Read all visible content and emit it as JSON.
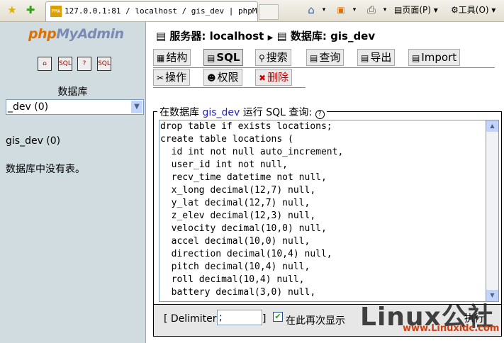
{
  "browser": {
    "tab_title": "127.0.0.1:81 / localhost / gis_dev | phpM...",
    "favicon_text": "PMA",
    "toolbar": {
      "page_label": "页面(P)",
      "tools_label": "工具(O)"
    }
  },
  "sidebar": {
    "logo_php": "php",
    "logo_myadmin": "MyAdmin",
    "icon_buttons": [
      "home",
      "SQL",
      "?",
      "SQL"
    ],
    "db_label": "数据库",
    "selected_db": "_dev (0)",
    "db_link": "gis_dev (0)",
    "empty_message": "数据库中没有表。"
  },
  "main": {
    "breadcrumb": {
      "server": "服务器: localhost",
      "database": "数据库: gis_dev"
    },
    "tabs_row1": [
      {
        "label": "结构",
        "icon": "structure-icon"
      },
      {
        "label": "SQL",
        "icon": "sql-icon",
        "active": true
      },
      {
        "label": "搜索",
        "icon": "search-icon"
      },
      {
        "label": "查询",
        "icon": "query-icon"
      },
      {
        "label": "导出",
        "icon": "export-icon"
      },
      {
        "label": "Import",
        "icon": "import-icon"
      }
    ],
    "tabs_row2": [
      {
        "label": "操作",
        "icon": "operations-icon"
      },
      {
        "label": "权限",
        "icon": "privileges-icon"
      },
      {
        "label": "删除",
        "icon": "drop-icon"
      }
    ],
    "query_legend": {
      "prefix": "在数据库",
      "db": "gis_dev",
      "suffix": "运行 SQL 查询:",
      "help": "?"
    },
    "sql_text": "drop table if exists locations;\ncreate table locations (\n  id int not null auto_increment,\n  user_id int not null,\n  recv_time datetime not null,\n  x_long decimal(12,7) null,\n  y_lat decimal(12,7) null,\n  z_elev decimal(12,3) null,\n  velocity decimal(10,0) null,\n  accel decimal(10,0) null,\n  direction decimal(10,4) null,\n  pitch decimal(10,4) null,\n  roll decimal(10,4) null,\n  battery decimal(3,0) null,",
    "delimiter_label": "[ Delimiter",
    "delimiter_value": ";",
    "delimiter_close": "]",
    "show_again_label": "在此再次显示",
    "show_again_checked": true,
    "go_label": "执行"
  },
  "watermark": {
    "text": "Linux公社",
    "url": "www.Linuxidc.com"
  }
}
